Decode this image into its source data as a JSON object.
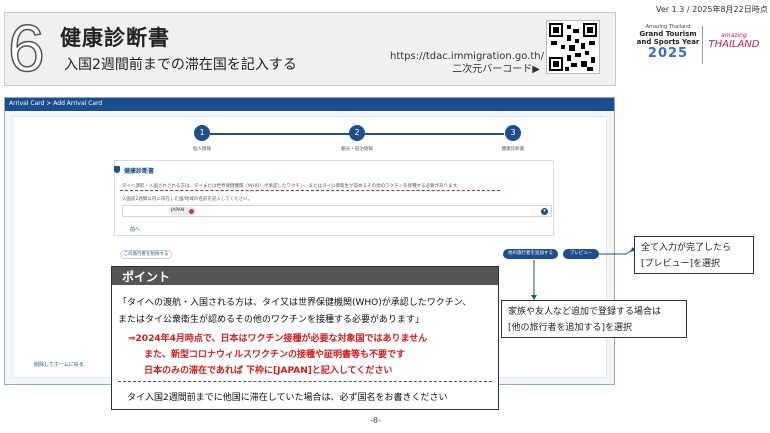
{
  "version": "Ver 1.3 / 2025年8月22日時点",
  "header": {
    "step_number": "6",
    "title": "健康診断書",
    "subtitle": "入国2週間前までの滞在国を記入する",
    "url": "https://tdac.immigration.go.th/",
    "qr_label": "二次元バーコード▶"
  },
  "logo": {
    "amazing_small": "Amazing Thailand",
    "grand_line1": "Grand Tourism",
    "grand_line2": "and Sports Year",
    "year": "2025",
    "amazing_th_small": "amazing",
    "thailand": "THAILAND"
  },
  "app": {
    "breadcrumb": "Arrival Card > Add Arrival Card",
    "steps": [
      {
        "num": "1",
        "label": "個人情報"
      },
      {
        "num": "2",
        "label": "観光・宿泊情報"
      },
      {
        "num": "3",
        "label": "健康診断書"
      }
    ],
    "card_title": "健康診断書",
    "card_desc": "タイへ渡航・入国されされる方は、タイまたは世界保健機関（WHO）が承認したワクチン、またはタイ公衆衛生が認めるその他のワクチンを接種する必要があります。",
    "card_question": "入国前2週間以内に滞在した国/地域の名前を記入してください。",
    "chip": "JAPAN",
    "back_link": "前へ",
    "delete_button": "この旅行者を削除する",
    "add_button": "他の旅行者を追加する",
    "preview_button": "プレビュー",
    "cancel_link": "削除してホームに戻る"
  },
  "point": {
    "heading": "ポイント",
    "line1": "「タイへの渡航・入国される方は、タイ又は世界保健機関(WHO)が承認したワクチン、",
    "line2": "またはタイ公衆衛生が認めるその他のワクチンを接種する必要があります」",
    "red1": "⇒2024年4月時点で、日本はワクチン接種が必要な対象国ではありません",
    "red2": "また、新型コロナウィルスワクチンの接種や証明書等も不要です",
    "red3": "日本のみの滞在であれば 下枠に[JAPAN]と記入してください",
    "bottom": "タイ入国2週間前までに他国に滞在していた場合は、必ず国名をお書きください"
  },
  "notes": {
    "n1_line1": "全て入力が完了したら",
    "n1_line2": "[プレビュー]を選択",
    "n2_line1": "家族や友人など追加で登録する場合は",
    "n2_line2": "[他の旅行者を追加する]を選択"
  },
  "page_number": "-8-",
  "colors": {
    "accent": "#1f4e8a",
    "red": "#d41a1a",
    "header_bg": "#f0f0f0"
  }
}
